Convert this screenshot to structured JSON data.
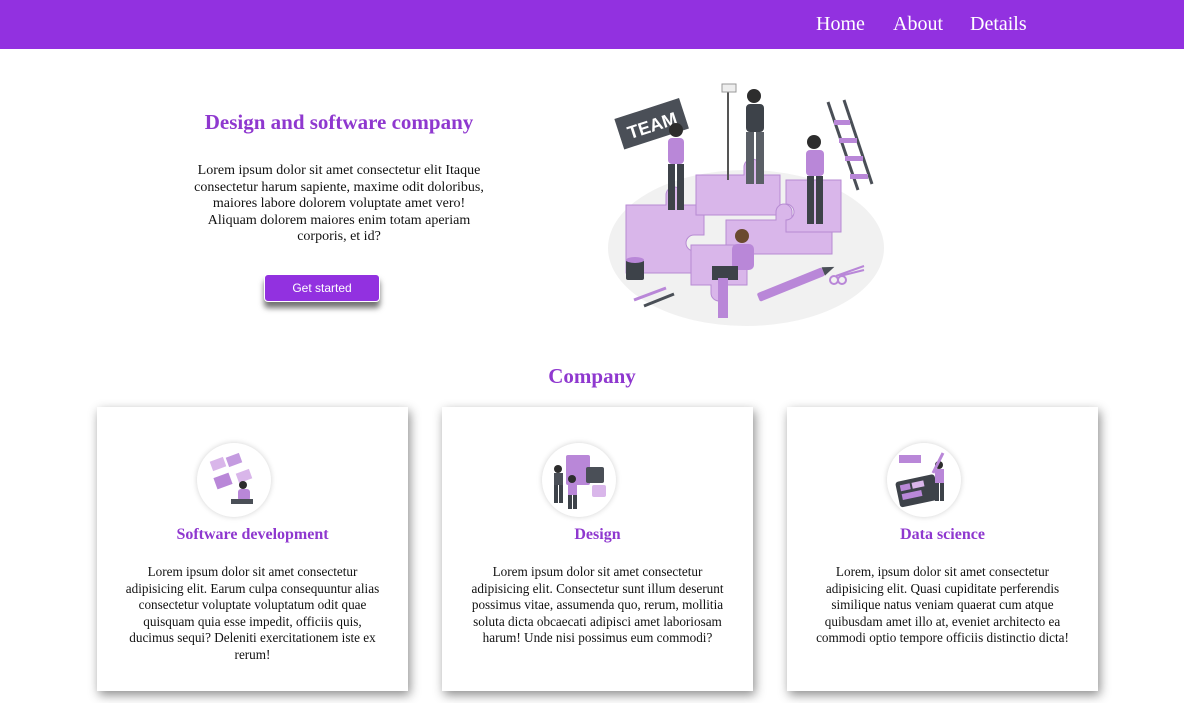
{
  "nav": {
    "items": [
      "Home",
      "About",
      "Details"
    ]
  },
  "hero": {
    "title": "Design and software company",
    "text": "Lorem ipsum dolor sit amet consectetur elit Itaque consectetur harum sapiente, maxime odit doloribus, maiores labore dolorem voluptate amet vero! Aliquam dolorem maiores enim totam aperiam corporis, et id?",
    "button_label": "Get started",
    "illustration_sign_text": "TEAM"
  },
  "company": {
    "title": "Company",
    "cards": [
      {
        "title": "Software development",
        "text": "Lorem ipsum dolor sit amet consectetur adipisicing elit. Earum culpa consequuntur alias consectetur voluptate voluptatum odit quae quisquam quia esse impedit, officiis quis, ducimus sequi? Deleniti exercitationem iste ex rerum!",
        "icon": "software-development-illustration-icon"
      },
      {
        "title": "Design",
        "text": "Lorem ipsum dolor sit amet consectetur adipisicing elit. Consectetur sunt illum deserunt possimus vitae, assumenda quo, rerum, mollitia soluta dicta obcaecati adipisci amet laboriosam harum! Unde nisi possimus eum commodi?",
        "icon": "design-illustration-icon"
      },
      {
        "title": "Data science",
        "text": "Lorem, ipsum dolor sit amet consectetur adipisicing elit. Quasi cupiditate perferendis similique natus veniam quaerat cum atque quibusdam amet illo at, eveniet architecto ea commodi optio tempore officiis distinctio dicta!",
        "icon": "data-science-illustration-icon"
      }
    ]
  },
  "colors": {
    "primary": "#9231e0",
    "heading": "#8f38cf",
    "light_purple": "#d7b2ea"
  }
}
